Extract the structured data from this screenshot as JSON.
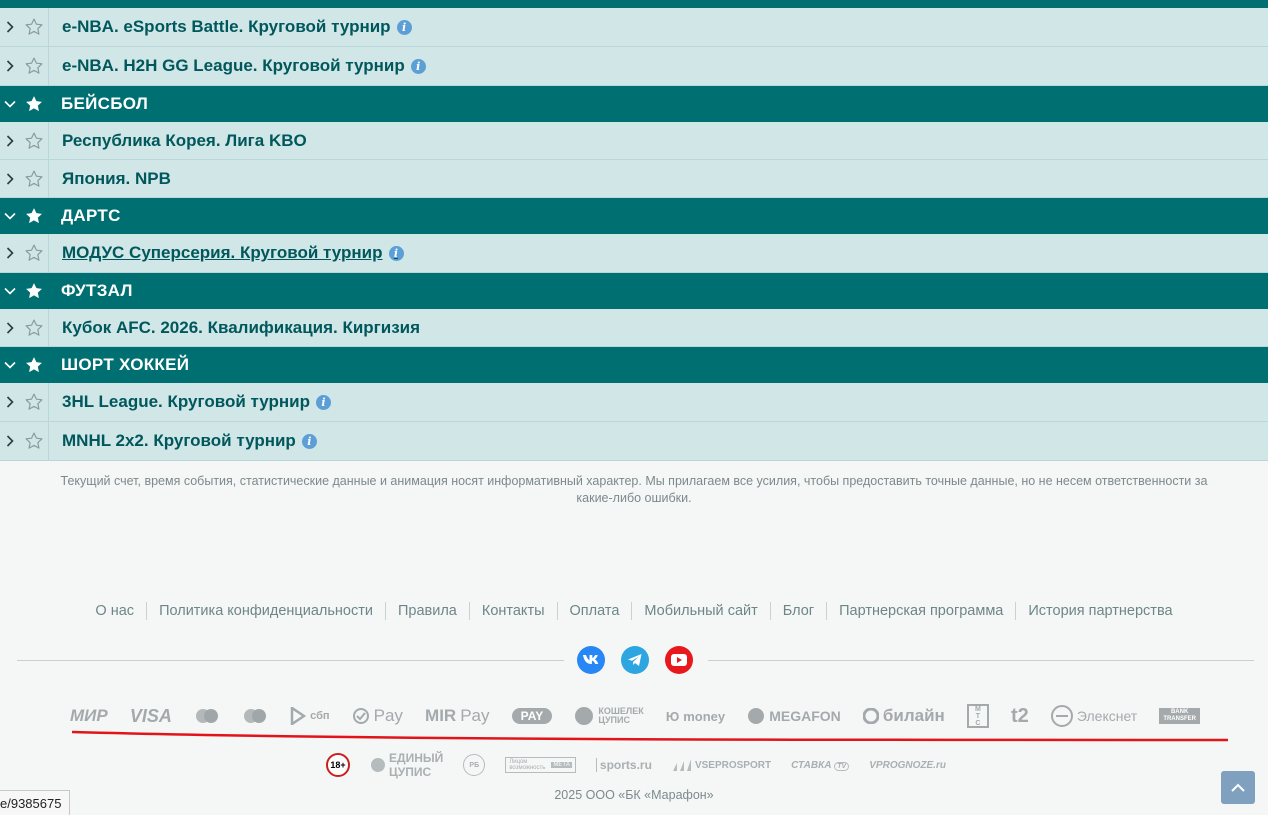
{
  "rows": [
    {
      "type": "league",
      "label": "e-NBA. eSports Battle. Круговой турнир",
      "info": true
    },
    {
      "type": "league",
      "label": "e-NBA. H2H GG League. Круговой турнир",
      "info": true
    },
    {
      "type": "sport",
      "label": "БЕЙСБОЛ"
    },
    {
      "type": "league",
      "label": "Республика Корея. Лига KBO",
      "info": false
    },
    {
      "type": "league",
      "label": "Япония. NPB",
      "info": false
    },
    {
      "type": "sport",
      "label": "ДАРТС"
    },
    {
      "type": "league",
      "label": "МОДУС Суперсерия. Круговой турнир",
      "info": true,
      "underline": true
    },
    {
      "type": "sport",
      "label": "ФУТЗАЛ"
    },
    {
      "type": "league",
      "label": "Кубок AFC. 2026. Квалификация. Киргизия",
      "info": false
    },
    {
      "type": "sport",
      "label": "ШОРТ ХОККЕЙ"
    },
    {
      "type": "league",
      "label": "3HL League. Круговой турнир",
      "info": true
    },
    {
      "type": "league",
      "label": "MNHL 2x2. Круговой турнир",
      "info": true
    }
  ],
  "info_glyph": "i",
  "disclaimer_line1": "Текущий счет, время события, статистические данные и анимация носят информативный характер. Мы прилагаем все усилия, чтобы предоставить точные данные, но не несем ответственности за",
  "disclaimer_line2": "какие-либо ошибки.",
  "footer_links": [
    "О нас",
    "Политика конфиденциальности",
    "Правила",
    "Контакты",
    "Оплата",
    "Мобильный сайт",
    "Блог",
    "Партнерская программа",
    "История партнерства"
  ],
  "social": {
    "vk": {
      "icon": "vk-icon",
      "color": "#2787f5",
      "text": "vk"
    },
    "telegram": {
      "icon": "telegram-icon",
      "color": "#2ca5e0"
    },
    "youtube": {
      "icon": "youtube-icon",
      "color": "#e8191d"
    }
  },
  "payments": {
    "mir": "МИР",
    "visa": "VISA",
    "sbp": "сбп",
    "gpay": "Pay",
    "mirpay_a": "MIR",
    "mirpay_b": "Pay",
    "tpay": "PAY",
    "koshelek_a": "КОШЕЛЕК",
    "koshelek_b": "ЦУПИС",
    "iomoney": "money",
    "megafon": "MEGAFON",
    "beeline": "билайн",
    "mts_a": "М",
    "mts_b": "Т",
    "mts_c": "С",
    "t2": "t2",
    "elecsnet": "Элекснет",
    "bank_a": "BANK",
    "bank_b": "TRANSFER"
  },
  "partners": {
    "age": "18+",
    "edinyi_a": "ЕДИНЫЙ",
    "edinyi_b": "ЦУПИС",
    "rb": "РБ",
    "legal_a": "Лицом",
    "legal_b": "возможность",
    "sports": "sports.ru",
    "vseprosport": "VSEPROSPORT",
    "stavka": "СТАВКА",
    "vprognoze": "VPROGNOZE.ru"
  },
  "copyright": "2025 ООО «БК «Марафон»",
  "status_url": "e/9385675",
  "colors": {
    "header": "#006f72",
    "row": "#d1e6e7",
    "text": "#00585c",
    "accent_red": "#e2141a"
  }
}
